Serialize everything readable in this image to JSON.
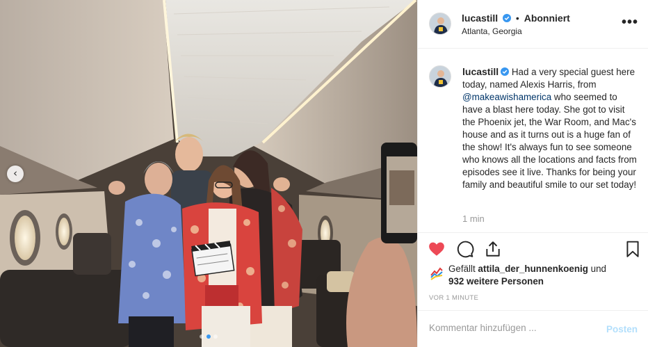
{
  "post": {
    "username": "lucastill",
    "follow_status": "Abonniert",
    "separator": "•",
    "location": "Atlanta, Georgia",
    "more_label": "•••",
    "caption_prefix": "Had a very special guest here today, named Alexis Harris, from ",
    "caption_mention": "@makeawishamerica",
    "caption_suffix": " who seemed to have a blast here today. She got to visit the Phoenix jet, the War Room, and Mac's house and as it turns out is a huge fan of the show! It's always fun to see someone who knows all the locations and facts from episodes see it live. Thanks for being your family and beautiful smile to our set today!",
    "comment_time": "1 min",
    "likes_prefix": "Gefällt ",
    "likes_user": "attila_der_hunnenkoenig",
    "likes_middle": " und",
    "likes_others": "932 weitere Personen",
    "post_age": "VOR 1 MINUTE",
    "comment_placeholder": "Kommentar hinzufügen ...",
    "post_button": "Posten",
    "carousel": {
      "total": 3,
      "active": 2
    }
  },
  "colors": {
    "like_red": "#ed4956",
    "verified_blue": "#3897f0",
    "link_blue": "#003569",
    "muted": "#999999",
    "post_button": "#b2dffc"
  },
  "icons": [
    "chevron-left-icon",
    "more-options-icon",
    "verified-badge-icon",
    "heart-icon",
    "comment-icon",
    "share-icon",
    "bookmark-icon"
  ]
}
